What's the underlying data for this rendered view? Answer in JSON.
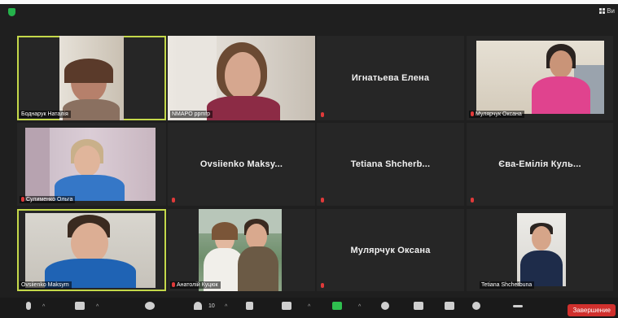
{
  "topbar": {
    "view_label": "Ви"
  },
  "tiles": [
    {
      "name": "Боднарук Наталія",
      "muted": false
    },
    {
      "name": "NMAPO ppmfp",
      "muted": false
    },
    {
      "name": "Игнатьева Елена",
      "muted": true
    },
    {
      "name": "Мулярчук Оксана",
      "muted": true
    },
    {
      "name": "Сулименко Ольга",
      "muted": true
    },
    {
      "name": "Ovsiienko  Maksy...",
      "muted": true
    },
    {
      "name": "Tetiana  Shcherb...",
      "muted": true
    },
    {
      "name": "Єва-Емілія Куль...",
      "muted": true
    },
    {
      "name": "Ovsiienko Maksym",
      "muted": false
    },
    {
      "name": "Анатолій Куцюк",
      "muted": true
    },
    {
      "name": "Мулярчук Оксана",
      "muted": true
    },
    {
      "name": "Tetiana Shcherbuna",
      "muted": false
    }
  ],
  "toolbar": {
    "participants_count": "10",
    "end_label": "Завершение"
  },
  "colors": {
    "active_speaker_border": "#c4d84a",
    "mute_red": "#e03a3a",
    "end_red": "#d0302d",
    "security_green": "#25b24b"
  }
}
